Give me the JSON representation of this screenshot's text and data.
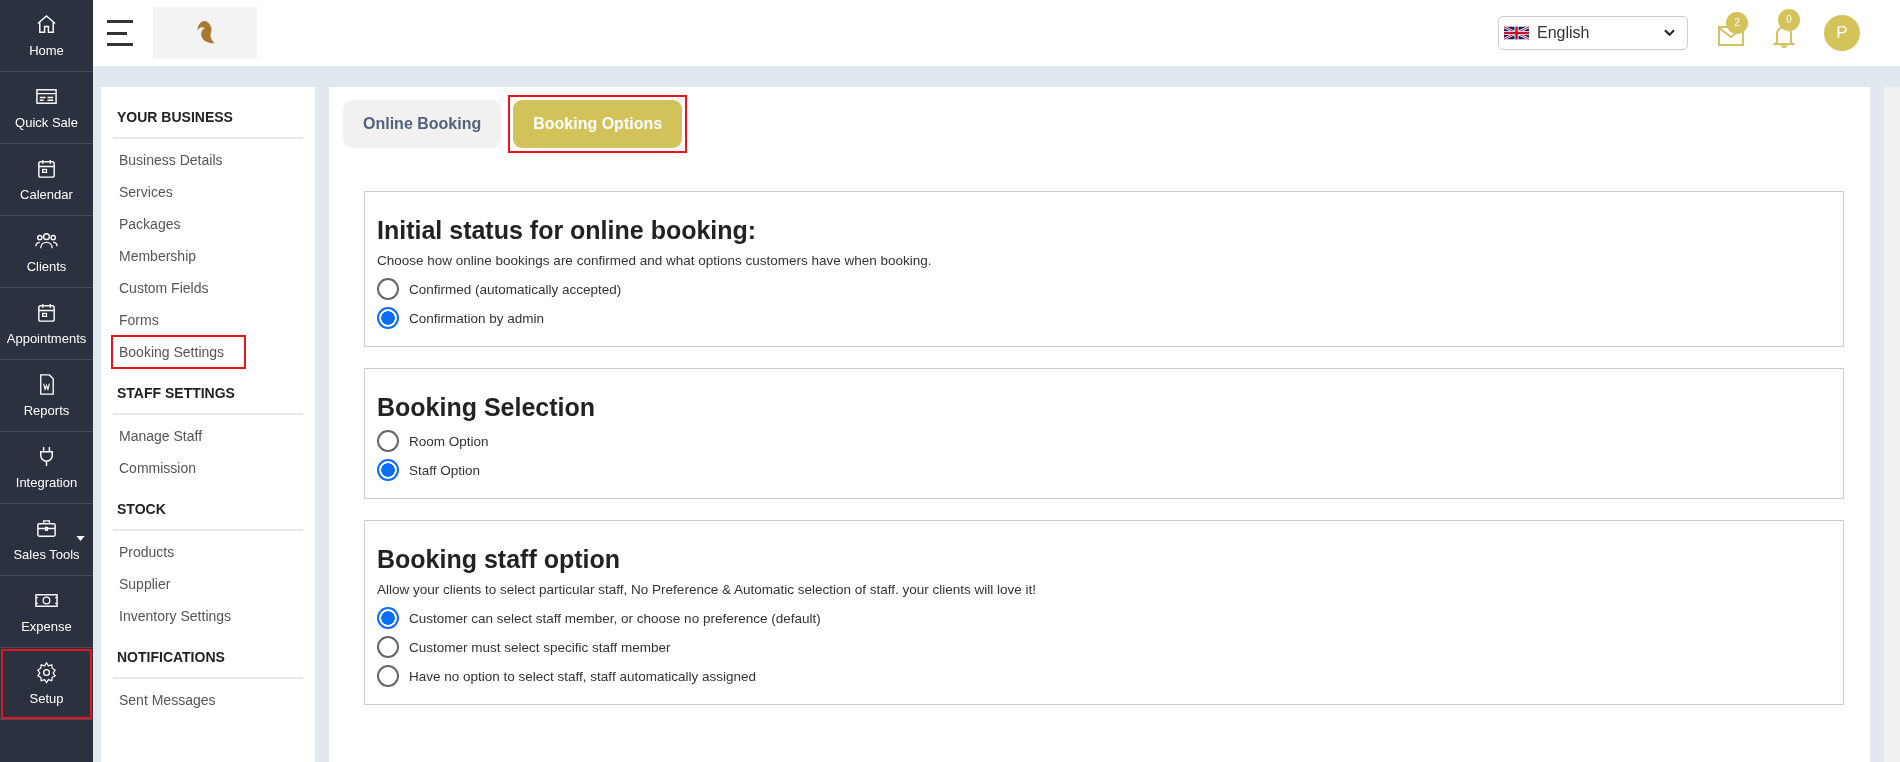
{
  "rail": [
    {
      "label": "Home",
      "kind": "home",
      "highlighted": false
    },
    {
      "label": "Quick Sale",
      "kind": "sale",
      "highlighted": false
    },
    {
      "label": "Calendar",
      "kind": "calendar",
      "highlighted": false
    },
    {
      "label": "Clients",
      "kind": "clients",
      "highlighted": false
    },
    {
      "label": "Appointments",
      "kind": "calendar",
      "highlighted": false
    },
    {
      "label": "Reports",
      "kind": "report",
      "highlighted": false
    },
    {
      "label": "Integration",
      "kind": "plug",
      "highlighted": false
    },
    {
      "label": "Sales Tools",
      "kind": "briefcase",
      "highlighted": false,
      "dropdown": true
    },
    {
      "label": "Expense",
      "kind": "money",
      "highlighted": false
    },
    {
      "label": "Setup",
      "kind": "gear",
      "highlighted": true
    }
  ],
  "topbar": {
    "language": "English",
    "mail_count": "2",
    "bell_count": "0",
    "avatar": "P"
  },
  "settings_nav": [
    {
      "heading": "YOUR BUSINESS",
      "items": [
        {
          "label": "Business Details",
          "highlighted": false
        },
        {
          "label": "Services",
          "highlighted": false
        },
        {
          "label": "Packages",
          "highlighted": false
        },
        {
          "label": "Membership",
          "highlighted": false
        },
        {
          "label": "Custom Fields",
          "highlighted": false
        },
        {
          "label": "Forms",
          "highlighted": false
        },
        {
          "label": "Booking Settings",
          "highlighted": true
        }
      ]
    },
    {
      "heading": "STAFF SETTINGS",
      "items": [
        {
          "label": "Manage Staff",
          "highlighted": false
        },
        {
          "label": "Commission",
          "highlighted": false
        }
      ]
    },
    {
      "heading": "STOCK",
      "items": [
        {
          "label": "Products",
          "highlighted": false
        },
        {
          "label": "Supplier",
          "highlighted": false
        },
        {
          "label": "Inventory Settings",
          "highlighted": false
        }
      ]
    },
    {
      "heading": "NOTIFICATIONS",
      "items": [
        {
          "label": "Sent Messages",
          "highlighted": false
        }
      ]
    }
  ],
  "tabs": [
    {
      "label": "Online Booking",
      "selected": false,
      "highlighted": false
    },
    {
      "label": "Booking Options",
      "selected": true,
      "highlighted": true
    }
  ],
  "sections": [
    {
      "title": "Initial status for online booking:",
      "description": "Choose how online bookings are confirmed and what options customers have when booking.",
      "options": [
        {
          "label": "Confirmed (automatically accepted)",
          "selected": false
        },
        {
          "label": "Confirmation by admin",
          "selected": true
        }
      ]
    },
    {
      "title": "Booking Selection",
      "options": [
        {
          "label": "Room Option",
          "selected": false
        },
        {
          "label": "Staff Option",
          "selected": true
        }
      ]
    },
    {
      "title": "Booking staff option",
      "description": "Allow your clients to select particular staff, No Preference & Automatic selection of staff. your clients will love it!",
      "options": [
        {
          "label": "Customer can select staff member, or choose no preference (default)",
          "selected": true
        },
        {
          "label": "Customer must select specific staff member",
          "selected": false
        },
        {
          "label": "Have no option to select staff, staff automatically assigned",
          "selected": false
        }
      ]
    }
  ]
}
